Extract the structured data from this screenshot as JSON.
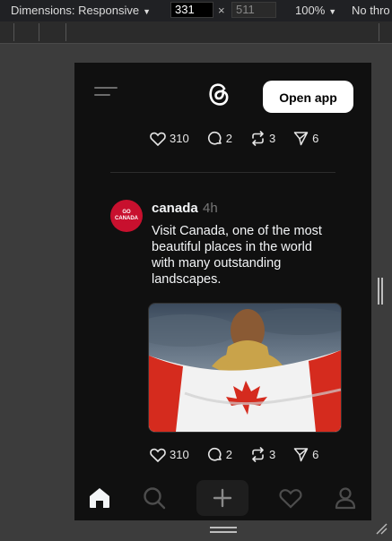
{
  "devtools": {
    "dimensions_label": "Dimensions: Responsive",
    "width_value": "331",
    "times": "×",
    "height_value": "511",
    "zoom_label": "100%",
    "throttle_label": "No thro"
  },
  "header": {
    "open_app_label": "Open app"
  },
  "previous_post": {
    "likes": "310",
    "replies": "2",
    "reposts": "3",
    "shares": "6"
  },
  "post": {
    "avatar_text_line1": "GO",
    "avatar_text_line2": "CANADA",
    "username": "canada",
    "time": "4h",
    "text": "Visit Canada, one of the most beautiful places in the world with many outstanding landscapes.",
    "likes": "310",
    "replies": "2",
    "reposts": "3",
    "shares": "6"
  },
  "icons": {
    "menu": "menu-icon",
    "logo": "threads-logo-icon",
    "like": "heart-icon",
    "reply": "comment-icon",
    "repost": "repost-icon",
    "share": "send-icon",
    "home": "home-icon",
    "search": "search-icon",
    "create": "plus-icon",
    "activity": "heart-icon",
    "profile": "profile-icon"
  },
  "colors": {
    "page_bg": "#101010",
    "text": "#f3f5f7",
    "secondary_text": "#777777",
    "avatar_red": "#c8102e",
    "button_bg": "#ffffff"
  }
}
